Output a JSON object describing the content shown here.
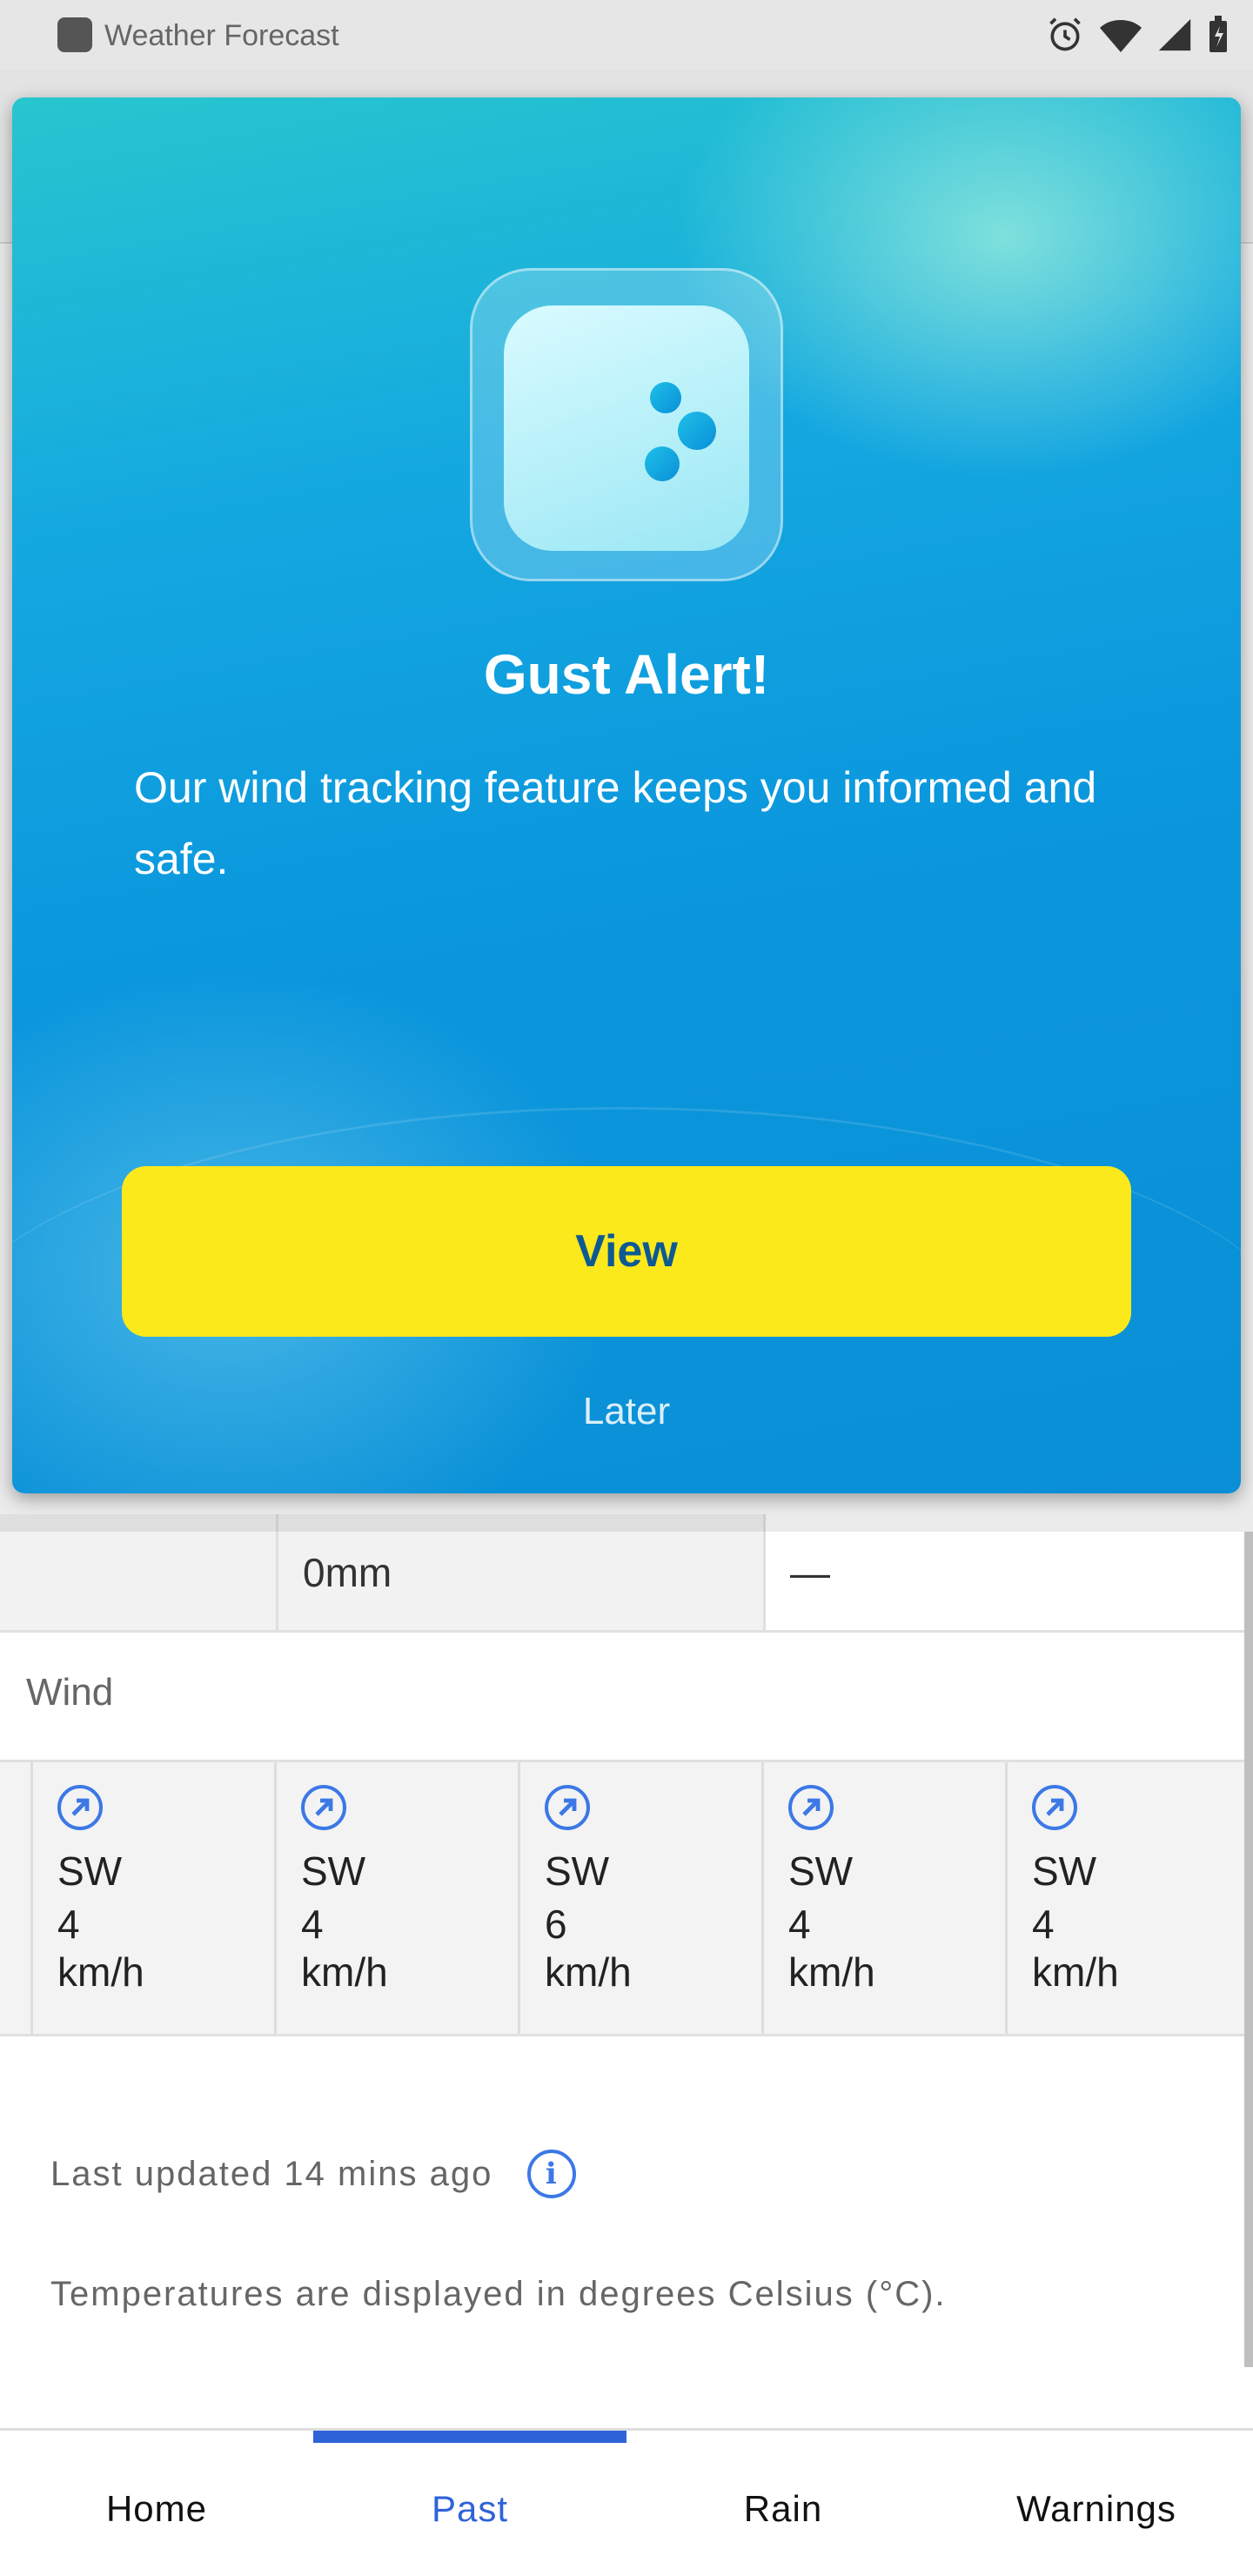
{
  "status_bar": {
    "app_title": "Weather Forecast",
    "icons": [
      "alarm-icon",
      "wifi-icon",
      "signal-icon",
      "battery-icon"
    ]
  },
  "modal": {
    "title": "Gust Alert!",
    "body": "Our wind tracking feature keeps you informed and safe.",
    "primary_button": "View",
    "secondary_button": "Later",
    "icon": "wind-icon",
    "colors": {
      "primary_button_bg": "#fbe91c",
      "primary_button_text": "#0d5a93"
    }
  },
  "precip_row": {
    "cells": [
      "0mm",
      "—"
    ]
  },
  "wind_section": {
    "label": "Wind",
    "columns": [
      {
        "direction": "SW",
        "speed": "4",
        "unit": "km/h"
      },
      {
        "direction": "SW",
        "speed": "4",
        "unit": "km/h"
      },
      {
        "direction": "SW",
        "speed": "6",
        "unit": "km/h"
      },
      {
        "direction": "SW",
        "speed": "4",
        "unit": "km/h"
      },
      {
        "direction": "SW",
        "speed": "4",
        "unit": "km/h"
      }
    ]
  },
  "footer": {
    "last_updated": "Last updated 14 mins ago",
    "units_note": "Temperatures are displayed in degrees Celsius (°C)."
  },
  "bottom_nav": {
    "items": [
      "Home",
      "Past",
      "Rain",
      "Warnings"
    ],
    "active": "Past",
    "accent": "#2f63d8"
  }
}
